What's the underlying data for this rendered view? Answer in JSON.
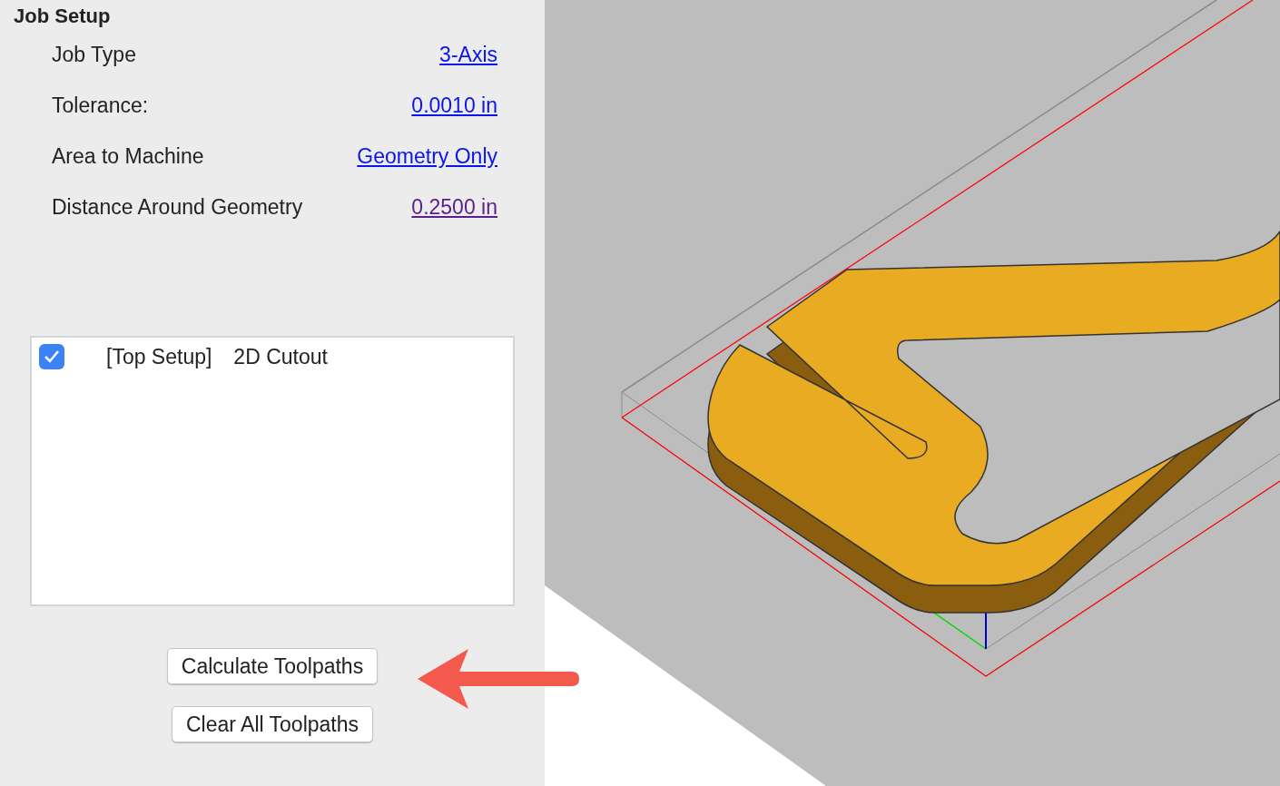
{
  "panel": {
    "title": "Job Setup",
    "settings": [
      {
        "label": "Job Type",
        "value": "3-Axis",
        "visited": false
      },
      {
        "label": "Tolerance:",
        "value": "0.0010 in",
        "visited": false
      },
      {
        "label": "Area to Machine",
        "value": "Geometry Only",
        "visited": false
      },
      {
        "label": "Distance Around Geometry",
        "value": "0.2500 in",
        "visited": true
      }
    ],
    "toolpaths": [
      {
        "setup": "[Top Setup]",
        "name": "2D Cutout",
        "checked": true
      }
    ],
    "buttons": [
      "Calculate Toolpaths",
      "Clear All Toolpaths"
    ]
  }
}
